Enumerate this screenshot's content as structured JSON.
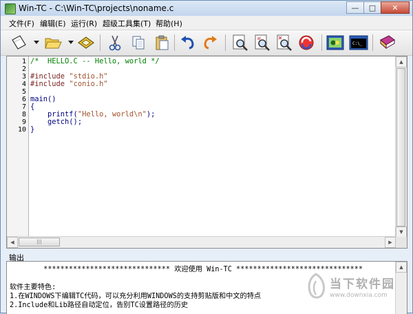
{
  "window": {
    "title": "Win-TC - C:\\Win-TC\\projects\\noname.c",
    "controls": {
      "minimize": "—",
      "maximize": "□",
      "close": "✕"
    }
  },
  "menu": [
    {
      "label": "文件(F)"
    },
    {
      "label": "编辑(E)"
    },
    {
      "label": "运行(R)"
    },
    {
      "label": "超级工具集(T)"
    },
    {
      "label": "帮助(H)"
    }
  ],
  "toolbar": {
    "icons": [
      "new-file-icon",
      "open-folder-icon",
      "save-icon",
      "cut-icon",
      "copy-icon",
      "paste-icon",
      "undo-icon",
      "redo-icon",
      "find-icon",
      "find-next-icon",
      "find-prev-icon",
      "replace-icon",
      "compile-icon",
      "run-console-icon",
      "help-book-icon"
    ]
  },
  "editor": {
    "line_numbers": [
      "1",
      "2",
      "3",
      "4",
      "5",
      "6",
      "7",
      "8",
      "9",
      "10"
    ],
    "lines": [
      {
        "parts": [
          {
            "t": "/*  HELLO.C -- Hello, world */",
            "c": "c-comment"
          }
        ]
      },
      {
        "parts": []
      },
      {
        "parts": [
          {
            "t": "#include ",
            "c": "c-pre"
          },
          {
            "t": "\"stdio.h\"",
            "c": "c-str"
          }
        ]
      },
      {
        "parts": [
          {
            "t": "#include ",
            "c": "c-pre"
          },
          {
            "t": "\"conio.h\"",
            "c": "c-str"
          }
        ]
      },
      {
        "parts": []
      },
      {
        "parts": [
          {
            "t": "main()",
            "c": "c-plain"
          }
        ]
      },
      {
        "parts": [
          {
            "t": "{",
            "c": "c-plain"
          }
        ]
      },
      {
        "parts": [
          {
            "t": "    printf(",
            "c": "c-plain"
          },
          {
            "t": "\"Hello, world\\n\"",
            "c": "c-str"
          },
          {
            "t": ");",
            "c": "c-plain"
          }
        ]
      },
      {
        "parts": [
          {
            "t": "    getch();",
            "c": "c-plain"
          }
        ]
      },
      {
        "parts": [
          {
            "t": "}",
            "c": "c-plain"
          }
        ]
      }
    ]
  },
  "output": {
    "label": "输出",
    "lines": [
      "        ****************************** 欢迎使用 Win-TC ******************************",
      "",
      "软件主要特色:",
      "1.在WINDOWS下编辑TC代码，可以充分利用WINDOWS的支持剪贴版和中文的特点",
      "2.Include和Lib路径自动定位，告别TC设置路径的历史"
    ]
  },
  "watermark": {
    "text": "当下软件园",
    "url": "www.downxia.com"
  }
}
